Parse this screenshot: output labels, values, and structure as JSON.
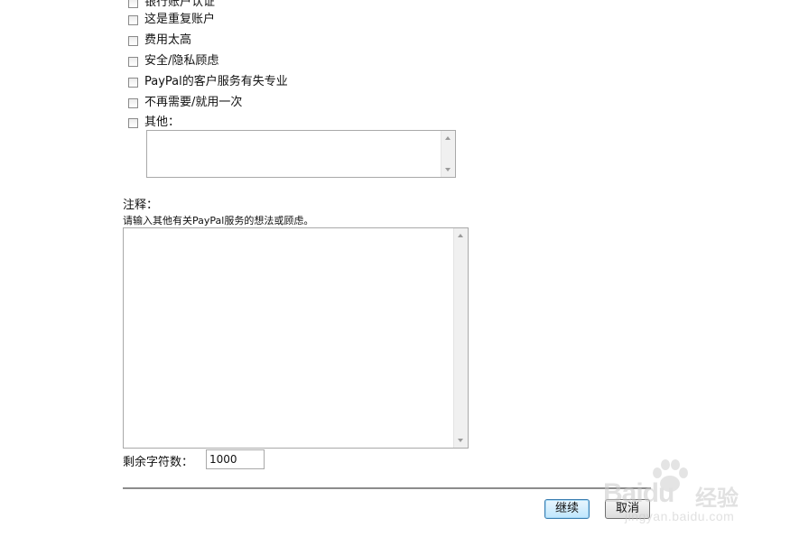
{
  "reasons": {
    "options": [
      {
        "label": "银行账户认证",
        "checked": false
      },
      {
        "label": "这是重复账户",
        "checked": false
      },
      {
        "label": "费用太高",
        "checked": false
      },
      {
        "label": "安全/隐私顾虑",
        "checked": false
      },
      {
        "label": "PayPal的客户服务有失专业",
        "checked": false
      },
      {
        "label": "不再需要/就用一次",
        "checked": false
      },
      {
        "label": "其他：",
        "checked": false
      }
    ],
    "other_text": ""
  },
  "comments": {
    "title": "注释：",
    "hint": "请输入其他有关PayPal服务的想法或顾虑。",
    "text": ""
  },
  "remaining": {
    "label": "剩余字符数：",
    "value": "1000"
  },
  "actions": {
    "continue_label": "继续",
    "cancel_label": "取消"
  },
  "watermark": {
    "brand": "Baidu",
    "suffix": "经验",
    "url": "jingyan.baidu.com"
  }
}
